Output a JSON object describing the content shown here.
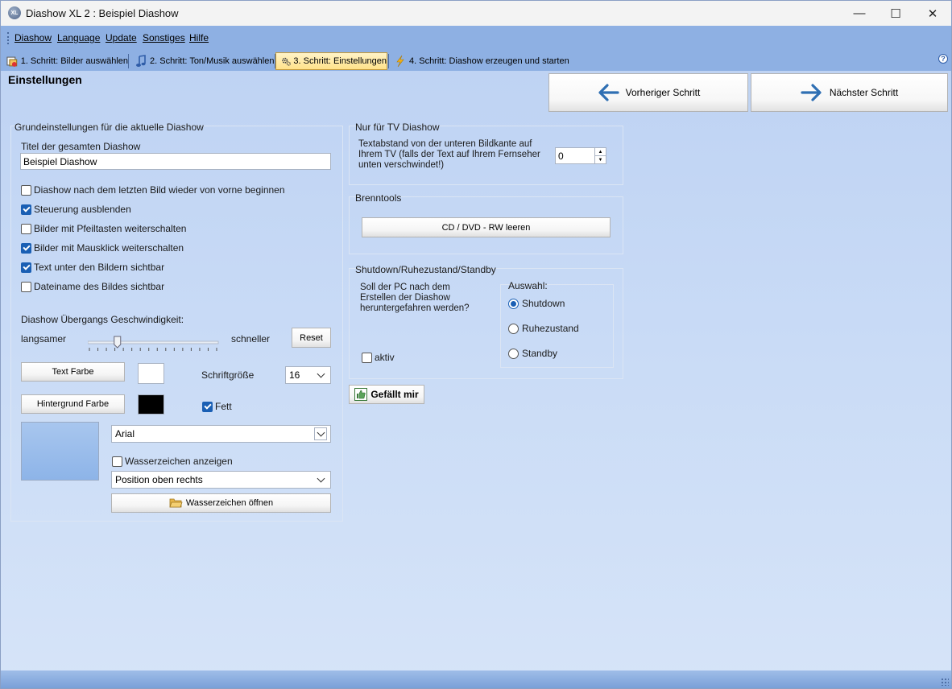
{
  "window": {
    "title": "Diashow XL 2 : Beispiel Diashow",
    "app_icon_text": "XL"
  },
  "window_controls": {
    "minimize": "—",
    "maximize": "☐",
    "close": "✕"
  },
  "menu": {
    "items": [
      "Diashow",
      "Language",
      "Update",
      "Sonstiges",
      "Hilfe"
    ]
  },
  "tabs": [
    {
      "label": "1. Schritt: Bilder auswählen",
      "icon": "images-icon",
      "active": false
    },
    {
      "label": "2. Schritt: Ton/Musik auswählen",
      "icon": "music-note-icon",
      "active": false
    },
    {
      "label": "3. Schritt: Einstellungen",
      "icon": "gears-icon",
      "active": true
    },
    {
      "label": "4. Schritt: Diashow erzeugen und starten",
      "icon": "lightning-icon",
      "active": false
    }
  ],
  "help": {
    "glyph": "?"
  },
  "header": {
    "title": "Einstellungen",
    "prev_label": "Vorheriger Schritt",
    "next_label": "Nächster Schritt"
  },
  "basic": {
    "group_title": "Grundeinstellungen für die aktuelle Diashow",
    "title_label": "Titel der gesamten Diashow",
    "title_value": "Beispiel Diashow",
    "checkboxes": [
      {
        "label": "Diashow nach dem letzten Bild wieder von vorne beginnen",
        "checked": false
      },
      {
        "label": "Steuerung ausblenden",
        "checked": true
      },
      {
        "label": "Bilder mit Pfeiltasten weiterschalten",
        "checked": false
      },
      {
        "label": "Bilder mit Mausklick weiterschalten",
        "checked": true
      },
      {
        "label": "Text unter den Bildern sichtbar",
        "checked": true
      },
      {
        "label": "Dateiname des Bildes sichtbar",
        "checked": false
      }
    ],
    "speed_label": "Diashow Übergangs Geschwindigkeit:",
    "slower_label": "langsamer",
    "faster_label": "schneller",
    "speed_value": 0.22,
    "reset_label": "Reset",
    "text_color_label": "Text Farbe",
    "text_color": "#ffffff",
    "font_size_label": "Schriftgröße",
    "font_size_value": "16",
    "bg_color_label": "Hintergrund Farbe",
    "bg_color": "#000000",
    "bold_label": "Fett",
    "bold_checked": true,
    "font_value": "Arial",
    "watermark_show_label": "Wasserzeichen anzeigen",
    "watermark_show_checked": false,
    "watermark_position_value": "Position oben rechts",
    "watermark_open_label": "Wasserzeichen öffnen"
  },
  "tv": {
    "group_title": "Nur für TV Diashow",
    "description": "Textabstand von der unteren Bildkante auf Ihrem TV (falls der Text auf Ihrem Fernseher unten verschwindet!)",
    "value": "0"
  },
  "burn": {
    "group_title": "Brenntools",
    "button_label": "CD / DVD - RW leeren"
  },
  "shutdown": {
    "group_title": "Shutdown/Ruhezustand/Standby",
    "question": "Soll der PC nach dem Erstellen der Diashow heruntergefahren werden?",
    "active_label": "aktiv",
    "active_checked": false,
    "choice_label": "Auswahl:",
    "options": [
      {
        "label": "Shutdown",
        "checked": true
      },
      {
        "label": "Ruhezustand",
        "checked": false
      },
      {
        "label": "Standby",
        "checked": false
      }
    ]
  },
  "like": {
    "label": "Gefällt mir"
  }
}
